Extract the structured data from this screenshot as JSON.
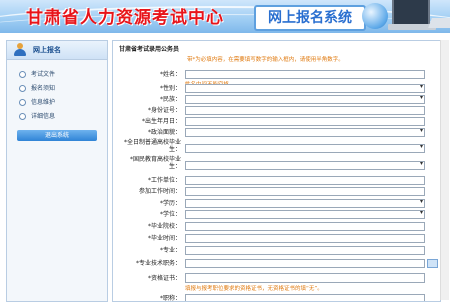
{
  "header": {
    "site_title": "甘肃省人力资源考试中心",
    "banner_text": "网上报名系统"
  },
  "sidebar": {
    "title": "网上报名",
    "items": [
      {
        "label": "考试文件"
      },
      {
        "label": "报名须知"
      },
      {
        "label": "信息维护"
      },
      {
        "label": "详细信息"
      }
    ],
    "logout_label": "退出系统"
  },
  "main": {
    "title": "甘肃省考试录用公务员",
    "notice": "带*为必填内容，在需要填写数字的输入框内，请使用半角数字。",
    "fields": [
      {
        "label": "*姓名：",
        "kind": "input",
        "hint": "姓名中间不能空格。"
      },
      {
        "label": "*性别：",
        "kind": "select"
      },
      {
        "label": "*民族：",
        "kind": "select"
      },
      {
        "label": "*身份证号：",
        "kind": "input"
      },
      {
        "label": "*出生年月日：",
        "kind": "input"
      },
      {
        "label": "*政治面貌：",
        "kind": "select"
      },
      {
        "label": "*全日制普通高校毕业",
        "label2": "生：",
        "kind": "select"
      },
      {
        "label": "*国民教育高校毕业",
        "label2": "生：",
        "kind": "select"
      },
      {
        "label": "*工作单位：",
        "kind": "input"
      },
      {
        "label": "参加工作时间：",
        "kind": "input"
      },
      {
        "label": "*学历：",
        "kind": "select"
      },
      {
        "label": "*学位：",
        "kind": "select"
      },
      {
        "label": "*毕业院校：",
        "kind": "input"
      },
      {
        "label": "*毕业时间：",
        "kind": "input"
      },
      {
        "label": "*专业：",
        "kind": "input"
      },
      {
        "label": "*专业技术职务：",
        "kind": "input"
      },
      {
        "label": "*资格证书：",
        "kind": "input",
        "hint": "填报与报考职位要求的资格证书，无资格证书的填“无”。"
      },
      {
        "label": "*职称：",
        "kind": "input"
      }
    ]
  },
  "colors": {
    "title_red": "#e8141a",
    "banner_blue": "#2a6fd0",
    "hint_orange": "#e07a10",
    "border_blue": "#b9cde3"
  }
}
